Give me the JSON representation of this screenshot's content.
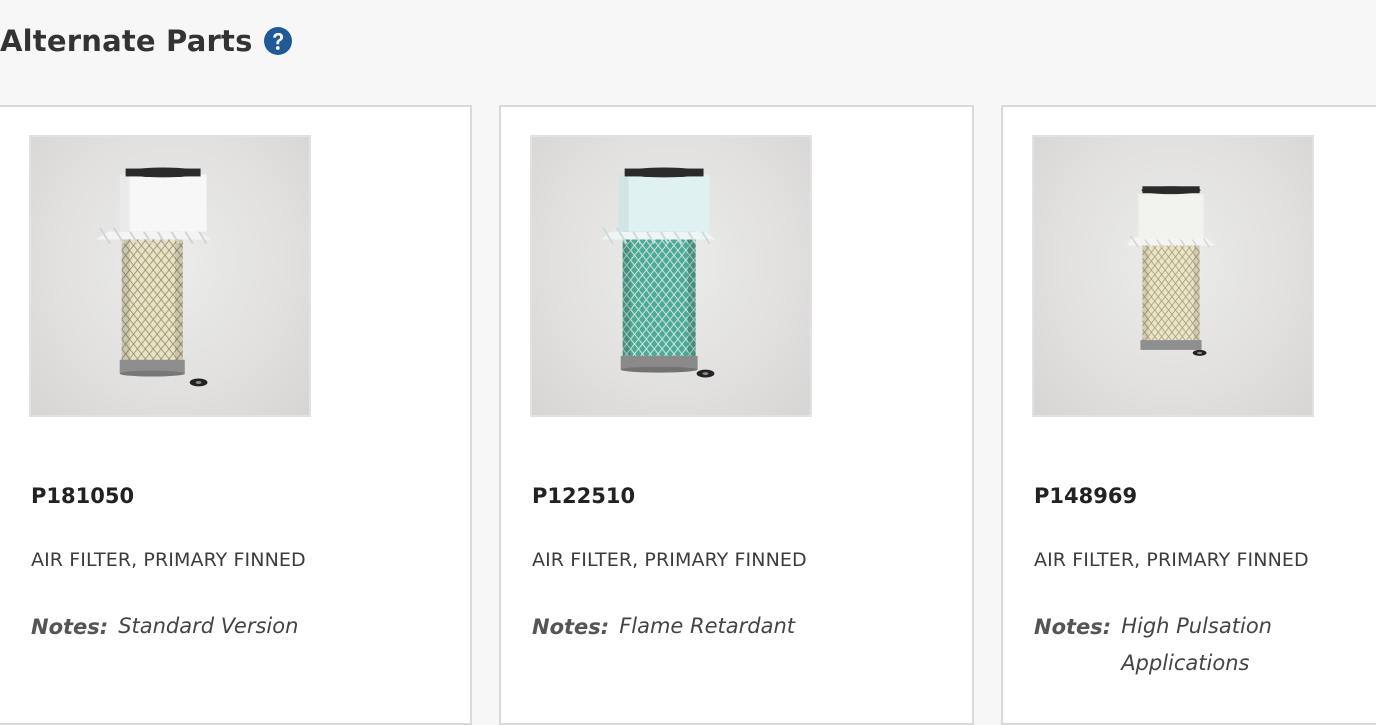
{
  "section": {
    "title": "Alternate Parts",
    "help_icon": "question-circle-icon",
    "help_color": "#1f5a96"
  },
  "notes_label": "Notes:",
  "parts": [
    {
      "part_number": "P181050",
      "description": "AIR FILTER, PRIMARY FINNED",
      "notes": "Standard Version",
      "filter_color": "cream"
    },
    {
      "part_number": "P122510",
      "description": "AIR FILTER, PRIMARY FINNED",
      "notes": "Flame Retardant",
      "filter_color": "teal"
    },
    {
      "part_number": "P148969",
      "description": "AIR FILTER, PRIMARY FINNED",
      "notes": "High Pulsation Applications",
      "filter_color": "cream"
    }
  ]
}
